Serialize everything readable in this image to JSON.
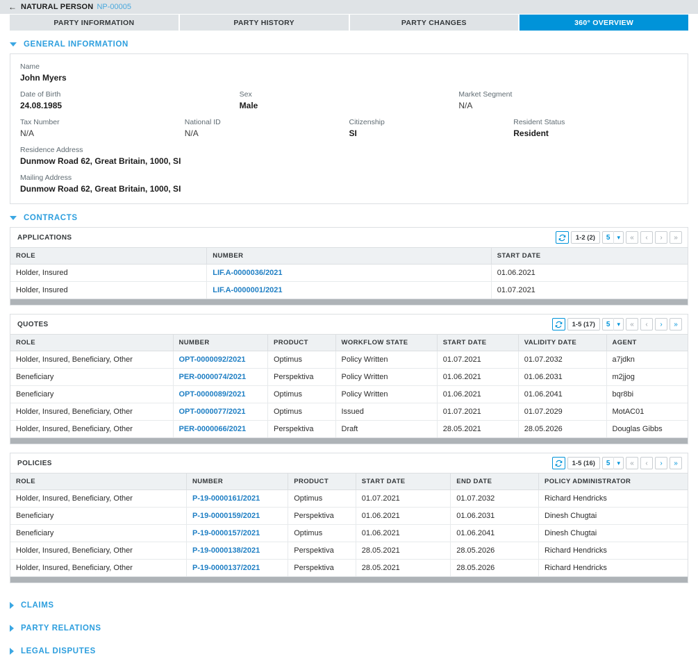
{
  "header": {
    "back_icon": "arrow-left-icon",
    "title": "NATURAL PERSON",
    "record_id": "NP-00005"
  },
  "tabs": [
    {
      "label": "PARTY INFORMATION",
      "active": false
    },
    {
      "label": "PARTY HISTORY",
      "active": false
    },
    {
      "label": "PARTY CHANGES",
      "active": false
    },
    {
      "label": "360° OVERVIEW",
      "active": true
    }
  ],
  "sections": {
    "general_information": {
      "title": "GENERAL INFORMATION",
      "expanded": true,
      "rows": [
        [
          {
            "label": "Name",
            "value": "John Myers",
            "na": false
          }
        ],
        [
          {
            "label": "Date of Birth",
            "value": "24.08.1985",
            "na": false
          },
          {
            "label": "Sex",
            "value": "Male",
            "na": false
          },
          {
            "label": "Market Segment",
            "value": "N/A",
            "na": true
          }
        ],
        [
          {
            "label": "Tax Number",
            "value": "N/A",
            "na": true
          },
          {
            "label": "National ID",
            "value": "N/A",
            "na": true
          },
          {
            "label": "Citizenship",
            "value": "SI",
            "na": false
          },
          {
            "label": "Resident Status",
            "value": "Resident",
            "na": false
          }
        ],
        [
          {
            "label": "Residence Address",
            "value": "Dunmow Road 62, Great Britain, 1000, SI",
            "na": false
          }
        ],
        [
          {
            "label": "Mailing Address",
            "value": "Dunmow Road 62, Great Britain, 1000, SI",
            "na": false
          }
        ]
      ]
    },
    "contracts": {
      "title": "CONTRACTS",
      "expanded": true,
      "tables": [
        {
          "name": "APPLICATIONS",
          "pager": {
            "refresh_icon": "refresh-icon",
            "range": "1-2 (2)",
            "page_size": "5",
            "dropdown_icon": "chevron-down-icon",
            "first_icon": "«",
            "prev_icon": "‹",
            "next_icon": "›",
            "last_icon": "»",
            "first_active": false,
            "prev_active": false,
            "next_active": false,
            "last_active": false
          },
          "columns": [
            "ROLE",
            "NUMBER",
            "START DATE"
          ],
          "widths": [
            "29%",
            "42%",
            "29%"
          ],
          "link_column": 1,
          "rows": [
            [
              "Holder, Insured",
              "LIF.A-0000036/2021",
              "01.06.2021"
            ],
            [
              "Holder, Insured",
              "LIF.A-0000001/2021",
              "01.07.2021"
            ]
          ]
        },
        {
          "name": "QUOTES",
          "pager": {
            "refresh_icon": "refresh-icon",
            "range": "1-5 (17)",
            "page_size": "5",
            "dropdown_icon": "chevron-down-icon",
            "first_icon": "«",
            "prev_icon": "‹",
            "next_icon": "›",
            "last_icon": "»",
            "first_active": false,
            "prev_active": false,
            "next_active": true,
            "last_active": true
          },
          "columns": [
            "ROLE",
            "NUMBER",
            "PRODUCT",
            "WORKFLOW STATE",
            "START DATE",
            "VALIDITY DATE",
            "AGENT"
          ],
          "widths": [
            "24%",
            "14%",
            "10%",
            "15%",
            "12%",
            "13%",
            "12%"
          ],
          "link_column": 1,
          "rows": [
            [
              "Holder, Insured, Beneficiary, Other",
              "OPT-0000092/2021",
              "Optimus",
              "Policy Written",
              "01.07.2021",
              "01.07.2032",
              "a7jdkn"
            ],
            [
              "Beneficiary",
              "PER-0000074/2021",
              "Perspektiva",
              "Policy Written",
              "01.06.2021",
              "01.06.2031",
              "m2jjog"
            ],
            [
              "Beneficiary",
              "OPT-0000089/2021",
              "Optimus",
              "Policy Written",
              "01.06.2021",
              "01.06.2041",
              "bqr8bi"
            ],
            [
              "Holder, Insured, Beneficiary, Other",
              "OPT-0000077/2021",
              "Optimus",
              "Issued",
              "01.07.2021",
              "01.07.2029",
              "MotAC01"
            ],
            [
              "Holder, Insured, Beneficiary, Other",
              "PER-0000066/2021",
              "Perspektiva",
              "Draft",
              "28.05.2021",
              "28.05.2026",
              "Douglas Gibbs"
            ]
          ]
        },
        {
          "name": "POLICIES",
          "pager": {
            "refresh_icon": "refresh-icon",
            "range": "1-5 (16)",
            "page_size": "5",
            "dropdown_icon": "chevron-down-icon",
            "first_icon": "«",
            "prev_icon": "‹",
            "next_icon": "›",
            "last_icon": "»",
            "first_active": false,
            "prev_active": false,
            "next_active": true,
            "last_active": true
          },
          "columns": [
            "ROLE",
            "NUMBER",
            "PRODUCT",
            "START DATE",
            "END DATE",
            "POLICY ADMINISTRATOR"
          ],
          "widths": [
            "26%",
            "15%",
            "10%",
            "14%",
            "13%",
            "22%"
          ],
          "link_column": 1,
          "rows": [
            [
              "Holder, Insured, Beneficiary, Other",
              "P-19-0000161/2021",
              "Optimus",
              "01.07.2021",
              "01.07.2032",
              "Richard Hendricks"
            ],
            [
              "Beneficiary",
              "P-19-0000159/2021",
              "Perspektiva",
              "01.06.2021",
              "01.06.2031",
              "Dinesh Chugtai"
            ],
            [
              "Beneficiary",
              "P-19-0000157/2021",
              "Optimus",
              "01.06.2021",
              "01.06.2041",
              "Dinesh Chugtai"
            ],
            [
              "Holder, Insured, Beneficiary, Other",
              "P-19-0000138/2021",
              "Perspektiva",
              "28.05.2021",
              "28.05.2026",
              "Richard Hendricks"
            ],
            [
              "Holder, Insured, Beneficiary, Other",
              "P-19-0000137/2021",
              "Perspektiva",
              "28.05.2021",
              "28.05.2026",
              "Richard Hendricks"
            ]
          ]
        }
      ]
    },
    "collapsed": [
      {
        "title": "CLAIMS",
        "expanded": false
      },
      {
        "title": "PARTY RELATIONS",
        "expanded": false
      },
      {
        "title": "LEGAL DISPUTES",
        "expanded": false
      }
    ]
  },
  "colors": {
    "accent": "#0093d9",
    "link": "#1f7fc4",
    "section_title": "#2c9ede",
    "topbar_bg": "#dfe3e6"
  }
}
